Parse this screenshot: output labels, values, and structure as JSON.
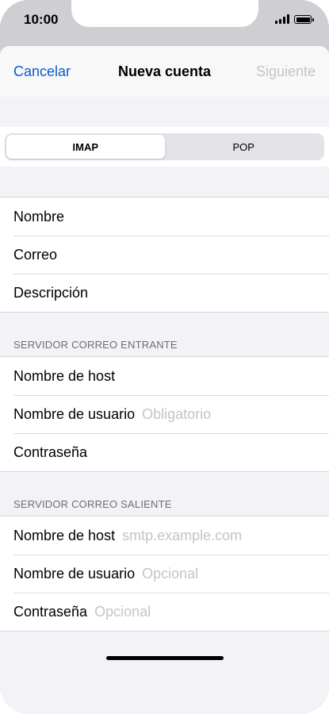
{
  "status_bar": {
    "time": "10:00",
    "icons": [
      "signal-icon",
      "battery-icon"
    ]
  },
  "nav": {
    "cancel_label": "Cancelar",
    "title": "Nueva cuenta",
    "next_label": "Siguiente"
  },
  "segmented": {
    "options": [
      "IMAP",
      "POP"
    ],
    "selected": "IMAP"
  },
  "account_fields": [
    {
      "label": "Nombre",
      "placeholder": ""
    },
    {
      "label": "Correo",
      "placeholder": ""
    },
    {
      "label": "Descripción",
      "placeholder": ""
    }
  ],
  "incoming": {
    "header": "SERVIDOR CORREO ENTRANTE",
    "fields": [
      {
        "label": "Nombre de host",
        "placeholder": ""
      },
      {
        "label": "Nombre de usuario",
        "placeholder": "Obligatorio"
      },
      {
        "label": "Contraseña",
        "placeholder": ""
      }
    ]
  },
  "outgoing": {
    "header": "SERVIDOR CORREO SALIENTE",
    "fields": [
      {
        "label": "Nombre de host",
        "placeholder": "smtp.example.com"
      },
      {
        "label": "Nombre de usuario",
        "placeholder": "Opcional"
      },
      {
        "label": "Contraseña",
        "placeholder": "Opcional"
      }
    ]
  },
  "colors": {
    "accent": "#0a5bd0",
    "disabled": "#c4c4c8",
    "grouped_background": "#f2f2f7"
  }
}
